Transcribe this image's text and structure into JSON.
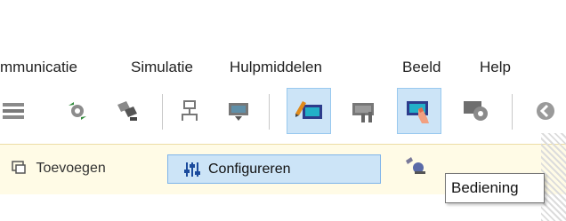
{
  "menu": [
    "mmunicatie",
    "Simulatie",
    "Hulpmiddelen",
    "Beeld",
    "Help"
  ],
  "toolbar_icons": [
    "list-icon",
    "gear-arrows-icon",
    "bottles-icon",
    "network-icon",
    "monitor-down-icon",
    "edit-panel-icon",
    "tools-panel-icon",
    "touch-panel-icon",
    "settings-gear-icon",
    "back-arrow-icon"
  ],
  "commands": {
    "add_label": "Toevoegen",
    "configure_label": "Configureren"
  },
  "tooltip": "Bediening",
  "colors": {
    "active": "#cce4f7",
    "active_border": "#7eb4ea",
    "cmdbar": "#fffbe6"
  }
}
